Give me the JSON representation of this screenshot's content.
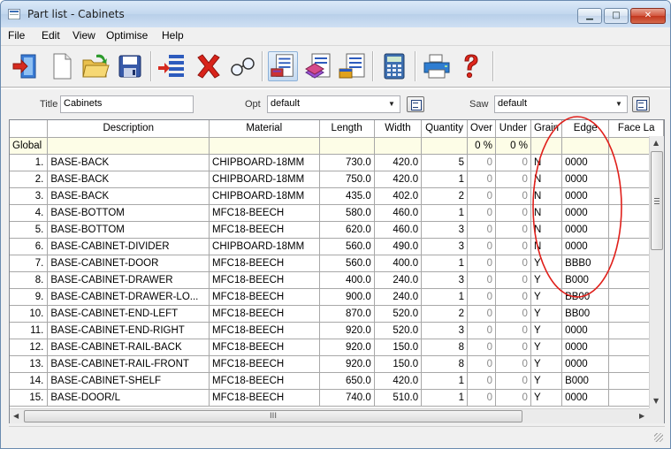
{
  "window": {
    "title": "Part list - Cabinets",
    "min_glyph": "▁",
    "max_glyph": "□",
    "close_glyph": "✕"
  },
  "menu": [
    "File",
    "Edit",
    "View",
    "Optimise",
    "Help"
  ],
  "toolbar": {
    "icons": [
      "exit-icon",
      "new-file-icon",
      "open-folder-icon",
      "save-icon",
      "insert-row-icon",
      "delete-icon",
      "search-glasses-icon",
      "part-list-icon",
      "board-list-icon",
      "edging-list-icon",
      "calculator-icon",
      "print-icon",
      "help-icon"
    ]
  },
  "options": {
    "title_label": "Title",
    "title_value": "Cabinets",
    "opt_label": "Opt",
    "opt_value": "default",
    "saw_label": "Saw",
    "saw_value": "default",
    "dropdown_glyph": "▼"
  },
  "grid": {
    "columns": [
      "",
      "Description",
      "Material",
      "Length",
      "Width",
      "Quantity",
      "Over",
      "Under",
      "Grain",
      "Edge",
      "Face La"
    ],
    "global_row": {
      "label": "Global",
      "over": "0 %",
      "under": "0 %"
    },
    "rows": [
      {
        "idx": "1.",
        "description": "BASE-BACK",
        "material": "CHIPBOARD-18MM",
        "length": "730.0",
        "width": "420.0",
        "quantity": "5",
        "over": "0",
        "under": "0",
        "grain": "N",
        "edge": "0000"
      },
      {
        "idx": "2.",
        "description": "BASE-BACK",
        "material": "CHIPBOARD-18MM",
        "length": "750.0",
        "width": "420.0",
        "quantity": "1",
        "over": "0",
        "under": "0",
        "grain": "N",
        "edge": "0000"
      },
      {
        "idx": "3.",
        "description": "BASE-BACK",
        "material": "CHIPBOARD-18MM",
        "length": "435.0",
        "width": "402.0",
        "quantity": "2",
        "over": "0",
        "under": "0",
        "grain": "N",
        "edge": "0000"
      },
      {
        "idx": "4.",
        "description": "BASE-BOTTOM",
        "material": "MFC18-BEECH",
        "length": "580.0",
        "width": "460.0",
        "quantity": "1",
        "over": "0",
        "under": "0",
        "grain": "N",
        "edge": "0000"
      },
      {
        "idx": "5.",
        "description": "BASE-BOTTOM",
        "material": "MFC18-BEECH",
        "length": "620.0",
        "width": "460.0",
        "quantity": "3",
        "over": "0",
        "under": "0",
        "grain": "N",
        "edge": "0000"
      },
      {
        "idx": "6.",
        "description": "BASE-CABINET-DIVIDER",
        "material": "CHIPBOARD-18MM",
        "length": "560.0",
        "width": "490.0",
        "quantity": "3",
        "over": "0",
        "under": "0",
        "grain": "N",
        "edge": "0000"
      },
      {
        "idx": "7.",
        "description": "BASE-CABINET-DOOR",
        "material": "MFC18-BEECH",
        "length": "560.0",
        "width": "400.0",
        "quantity": "1",
        "over": "0",
        "under": "0",
        "grain": "Y",
        "edge": "BBB0"
      },
      {
        "idx": "8.",
        "description": "BASE-CABINET-DRAWER",
        "material": "MFC18-BEECH",
        "length": "400.0",
        "width": "240.0",
        "quantity": "3",
        "over": "0",
        "under": "0",
        "grain": "Y",
        "edge": "B000"
      },
      {
        "idx": "9.",
        "description": "BASE-CABINET-DRAWER-LO...",
        "material": "MFC18-BEECH",
        "length": "900.0",
        "width": "240.0",
        "quantity": "1",
        "over": "0",
        "under": "0",
        "grain": "Y",
        "edge": "BB00"
      },
      {
        "idx": "10.",
        "description": "BASE-CABINET-END-LEFT",
        "material": "MFC18-BEECH",
        "length": "870.0",
        "width": "520.0",
        "quantity": "2",
        "over": "0",
        "under": "0",
        "grain": "Y",
        "edge": "BB00"
      },
      {
        "idx": "11.",
        "description": "BASE-CABINET-END-RIGHT",
        "material": "MFC18-BEECH",
        "length": "920.0",
        "width": "520.0",
        "quantity": "3",
        "over": "0",
        "under": "0",
        "grain": "Y",
        "edge": "0000"
      },
      {
        "idx": "12.",
        "description": "BASE-CABINET-RAIL-BACK",
        "material": "MFC18-BEECH",
        "length": "920.0",
        "width": "150.0",
        "quantity": "8",
        "over": "0",
        "under": "0",
        "grain": "Y",
        "edge": "0000"
      },
      {
        "idx": "13.",
        "description": "BASE-CABINET-RAIL-FRONT",
        "material": "MFC18-BEECH",
        "length": "920.0",
        "width": "150.0",
        "quantity": "8",
        "over": "0",
        "under": "0",
        "grain": "Y",
        "edge": "0000"
      },
      {
        "idx": "14.",
        "description": "BASE-CABINET-SHELF",
        "material": "MFC18-BEECH",
        "length": "650.0",
        "width": "420.0",
        "quantity": "1",
        "over": "0",
        "under": "0",
        "grain": "Y",
        "edge": "B000"
      },
      {
        "idx": "15.",
        "description": "BASE-DOOR/L",
        "material": "MFC18-BEECH",
        "length": "740.0",
        "width": "510.0",
        "quantity": "1",
        "over": "0",
        "under": "0",
        "grain": "Y",
        "edge": "0000"
      }
    ],
    "scroll_glyphs": {
      "up": "▲",
      "down": "▼",
      "left": "◀",
      "right": "▶",
      "h_grip": "III"
    }
  },
  "colors": {
    "annotation": "#e0201b",
    "global_row_bg": "#fdfde7"
  }
}
